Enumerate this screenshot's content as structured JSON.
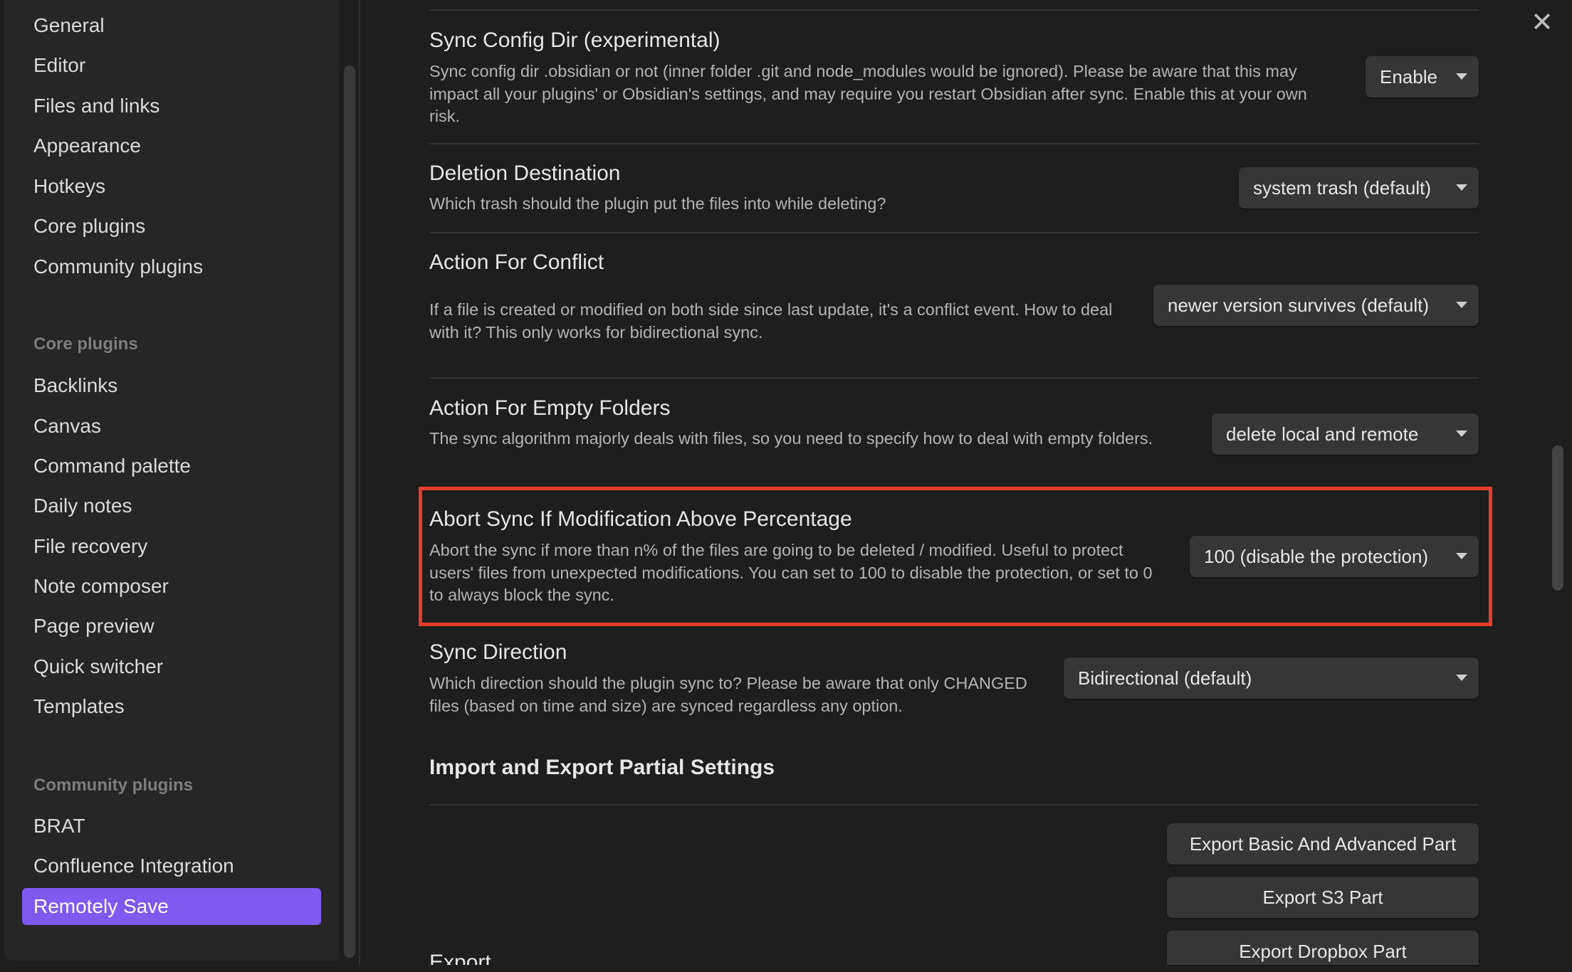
{
  "window": {
    "close_label": "✕"
  },
  "sidebar": {
    "options": [
      "General",
      "Editor",
      "Files and links",
      "Appearance",
      "Hotkeys",
      "Core plugins",
      "Community plugins"
    ],
    "core_heading": "Core plugins",
    "core": [
      "Backlinks",
      "Canvas",
      "Command palette",
      "Daily notes",
      "File recovery",
      "Note composer",
      "Page preview",
      "Quick switcher",
      "Templates"
    ],
    "community_heading": "Community plugins",
    "community": [
      "BRAT",
      "Confluence Integration",
      "Remotely Save"
    ],
    "active": "Remotely Save"
  },
  "settings": {
    "sync_config_dir": {
      "title": "Sync Config Dir (experimental)",
      "desc": "Sync config dir .obsidian or not (inner folder .git and node_modules would be ignored). Please be aware that this may impact all your plugins' or Obsidian's settings, and may require you restart Obsidian after sync. Enable this at your own risk.",
      "value": "Enable"
    },
    "deletion_destination": {
      "title": "Deletion Destination",
      "desc": "Which trash should the plugin put the files into while deleting?",
      "value": "system trash (default)"
    },
    "action_for_conflict": {
      "title": "Action For Conflict",
      "desc": "If a file is created or modified on both side since last update, it's a conflict event. How to deal with it? This only works for bidirectional sync.",
      "value": "newer version survives (default)"
    },
    "action_for_empty_folders": {
      "title": "Action For Empty Folders",
      "desc": "The sync algorithm majorly deals with files, so you need to specify how to deal with empty folders.",
      "value": "delete local and remote"
    },
    "abort_sync": {
      "title": "Abort Sync If Modification Above Percentage",
      "desc": "Abort the sync if more than n% of the files are going to be deleted / modified. Useful to protect users' files from unexpected modifications. You can set to 100 to disable the protection, or set to 0 to always block the sync.",
      "value": "100 (disable the protection)"
    },
    "sync_direction": {
      "title": "Sync Direction",
      "desc": "Which direction should the plugin sync to? Please be aware that only CHANGED files (based on time and size) are synced regardless any option.",
      "value": "Bidirectional (default)"
    }
  },
  "import_export": {
    "heading": "Import and Export Partial Settings",
    "export_basic": "Export Basic And Advanced Part",
    "export_s3": "Export S3 Part",
    "export_dropbox": "Export Dropbox Part",
    "export_label": "Export"
  }
}
